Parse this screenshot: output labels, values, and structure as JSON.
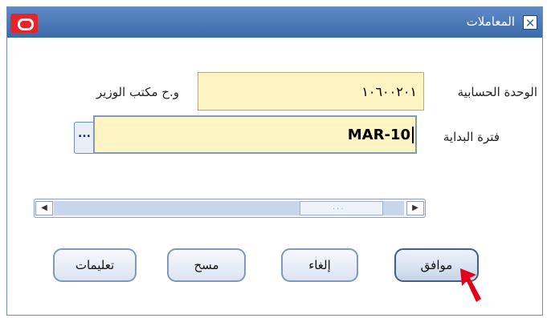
{
  "window": {
    "title": "المعاملات"
  },
  "form": {
    "accounting_unit_label": "الوحدة الحسابية",
    "accounting_unit_value": "١٠٦٠٠٢٠١",
    "accounting_unit_desc": "و.ح مكتب الوزير",
    "start_period_label": "فترة البداية",
    "start_period_value": "MAR-10",
    "lov_button_label": "..."
  },
  "scrollbar": {
    "left_arrow": "◀",
    "right_arrow": "▶",
    "grip": "..."
  },
  "buttons": {
    "ok": "موافق",
    "cancel": "إلغاء",
    "clear": "مسح",
    "help": "تعليمات"
  },
  "colors": {
    "title_bar": "#3c6aa9",
    "field_bg": "#fff4c4",
    "oracle_red": "#e4262a",
    "cursor": "#e3001b"
  }
}
